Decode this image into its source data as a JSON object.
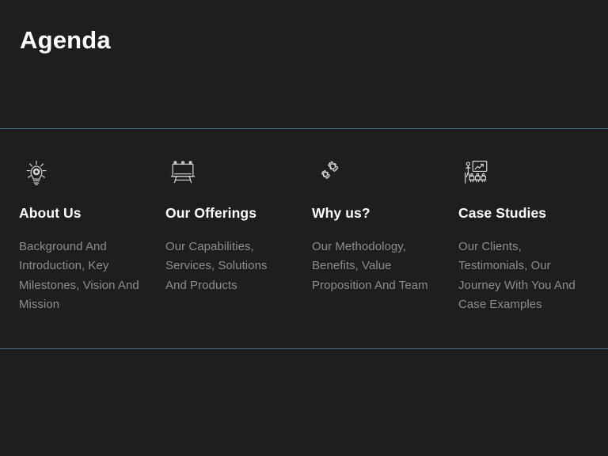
{
  "slide": {
    "title": "Agenda",
    "background_color": "#1e1e1e",
    "divider_color": "#3d6e91",
    "title_color": "#ffffff",
    "heading_color": "#ffffff",
    "body_color": "#8d8d8d"
  },
  "columns": [
    {
      "icon": "lightbulb-gear-icon",
      "title": "About Us",
      "description": "Background And Introduction, Key Milestones, Vision And Mission"
    },
    {
      "icon": "easel-board-icon",
      "title": "Our Offerings",
      "description": "Our Capabilities, Services, Solutions And Products"
    },
    {
      "icon": "gears-icon",
      "title": "Why us?",
      "description": "Our Methodology, Benefits, Value Proposition And Team"
    },
    {
      "icon": "presentation-audience-icon",
      "title": "Case Studies",
      "description": "Our Clients, Testimonials, Our Journey With You And Case Examples"
    }
  ]
}
